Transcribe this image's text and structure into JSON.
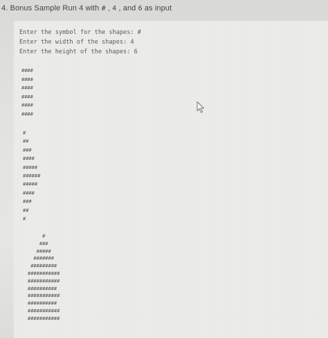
{
  "heading": {
    "prefix": "4. Bonus Sample Run 4 with ",
    "symbol": "#",
    "sep1": " , ",
    "width": "4",
    "sep2": " , and ",
    "height": "6",
    "suffix": " as input"
  },
  "console": {
    "prompts": [
      "Enter the symbol for the shapes: #",
      "Enter the width of the shapes: 4",
      "Enter the height of the shapes: 6"
    ],
    "square": "####\n####\n####\n####\n####\n####",
    "arrow": "#\n##\n###\n####\n#####\n######\n#####\n####\n###\n##\n#",
    "pyramid": "     #\n    ###\n   #####\n  #######\n #########\n###########\n###########\n##########\n###########\n##########\n###########\n###########"
  },
  "icons": {
    "cursor": "mouse-pointer-icon"
  }
}
